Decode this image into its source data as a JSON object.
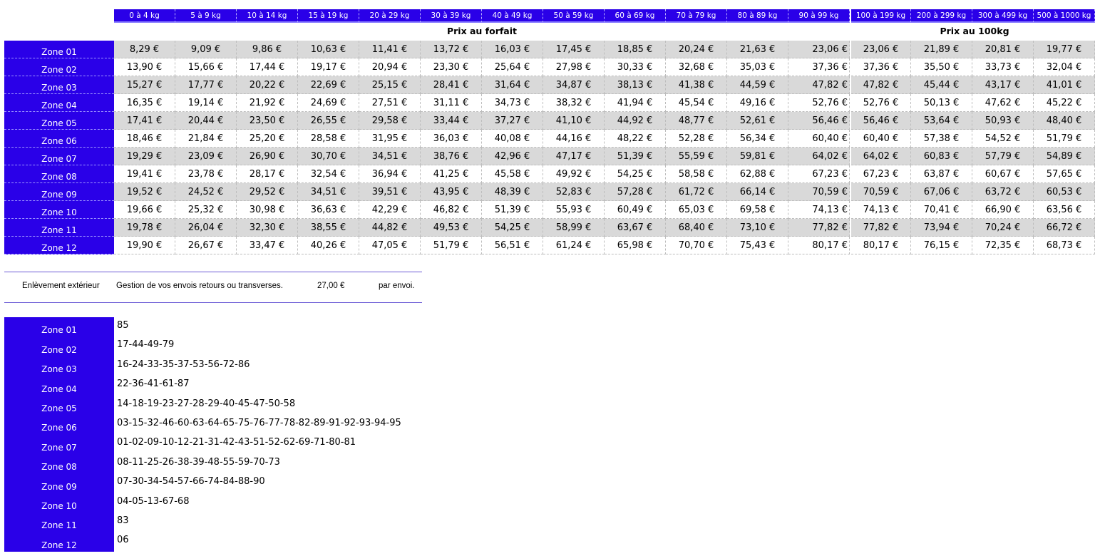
{
  "header": {
    "weights": [
      "0 à 4 kg",
      "5 à 9 kg",
      "10 à 14 kg",
      "15 à 19 kg",
      "20 à 29 kg",
      "30 à 39 kg",
      "40 à 49 kg",
      "50 à 59 kg",
      "60 à 69 kg",
      "70 à 79 kg",
      "80 à 89 kg",
      "90 à 99 kg",
      "100 à 199 kg",
      "200 à 299 kg",
      "300 à 499 kg",
      "500 à 1000 kg"
    ],
    "forfait_label": "Prix au forfait",
    "per100_label": "Prix au 100kg"
  },
  "price_rows": [
    {
      "zone": "Zone 01",
      "prices": [
        "8,29 €",
        "9,09 €",
        "9,86 €",
        "10,63 €",
        "11,41 €",
        "13,72 €",
        "16,03 €",
        "17,45 €",
        "18,85 €",
        "20,24 €",
        "21,63 €",
        "23,06 €",
        "23,06 €",
        "21,89 €",
        "20,81 €",
        "19,77 €"
      ]
    },
    {
      "zone": "Zone 02",
      "prices": [
        "13,90 €",
        "15,66 €",
        "17,44 €",
        "19,17 €",
        "20,94 €",
        "23,30 €",
        "25,64 €",
        "27,98 €",
        "30,33 €",
        "32,68 €",
        "35,03 €",
        "37,36 €",
        "37,36 €",
        "35,50 €",
        "33,73 €",
        "32,04 €"
      ]
    },
    {
      "zone": "Zone 03",
      "prices": [
        "15,27 €",
        "17,77 €",
        "20,22 €",
        "22,69 €",
        "25,15 €",
        "28,41 €",
        "31,64 €",
        "34,87 €",
        "38,13 €",
        "41,38 €",
        "44,59 €",
        "47,82 €",
        "47,82 €",
        "45,44 €",
        "43,17 €",
        "41,01 €"
      ]
    },
    {
      "zone": "Zone 04",
      "prices": [
        "16,35 €",
        "19,14 €",
        "21,92 €",
        "24,69 €",
        "27,51 €",
        "31,11 €",
        "34,73 €",
        "38,32 €",
        "41,94 €",
        "45,54 €",
        "49,16 €",
        "52,76 €",
        "52,76 €",
        "50,13 €",
        "47,62 €",
        "45,22 €"
      ]
    },
    {
      "zone": "Zone 05",
      "prices": [
        "17,41 €",
        "20,44 €",
        "23,50 €",
        "26,55 €",
        "29,58 €",
        "33,44 €",
        "37,27 €",
        "41,10 €",
        "44,92 €",
        "48,77 €",
        "52,61 €",
        "56,46 €",
        "56,46 €",
        "53,64 €",
        "50,93 €",
        "48,40 €"
      ]
    },
    {
      "zone": "Zone 06",
      "prices": [
        "18,46 €",
        "21,84 €",
        "25,20 €",
        "28,58 €",
        "31,95 €",
        "36,03 €",
        "40,08 €",
        "44,16 €",
        "48,22 €",
        "52,28 €",
        "56,34 €",
        "60,40 €",
        "60,40 €",
        "57,38 €",
        "54,52 €",
        "51,79 €"
      ]
    },
    {
      "zone": "Zone 07",
      "prices": [
        "19,29 €",
        "23,09 €",
        "26,90 €",
        "30,70 €",
        "34,51 €",
        "38,76 €",
        "42,96 €",
        "47,17 €",
        "51,39 €",
        "55,59 €",
        "59,81 €",
        "64,02 €",
        "64,02 €",
        "60,83 €",
        "57,79 €",
        "54,89 €"
      ]
    },
    {
      "zone": "Zone 08",
      "prices": [
        "19,41 €",
        "23,78 €",
        "28,17 €",
        "32,54 €",
        "36,94 €",
        "41,25 €",
        "45,58 €",
        "49,92 €",
        "54,25 €",
        "58,58 €",
        "62,88 €",
        "67,23 €",
        "67,23 €",
        "63,87 €",
        "60,67 €",
        "57,65 €"
      ]
    },
    {
      "zone": "Zone 09",
      "prices": [
        "19,52 €",
        "24,52 €",
        "29,52 €",
        "34,51 €",
        "39,51 €",
        "43,95 €",
        "48,39 €",
        "52,83 €",
        "57,28 €",
        "61,72 €",
        "66,14 €",
        "70,59 €",
        "70,59 €",
        "67,06 €",
        "63,72 €",
        "60,53 €"
      ]
    },
    {
      "zone": "Zone 10",
      "prices": [
        "19,66 €",
        "25,32 €",
        "30,98 €",
        "36,63 €",
        "42,29 €",
        "46,82 €",
        "51,39 €",
        "55,93 €",
        "60,49 €",
        "65,03 €",
        "69,58 €",
        "74,13 €",
        "74,13 €",
        "70,41 €",
        "66,90 €",
        "63,56 €"
      ]
    },
    {
      "zone": "Zone 11",
      "prices": [
        "19,78 €",
        "26,04 €",
        "32,30 €",
        "38,55 €",
        "44,82 €",
        "49,53 €",
        "54,25 €",
        "58,99 €",
        "63,67 €",
        "68,40 €",
        "73,10 €",
        "77,82 €",
        "77,82 €",
        "73,94 €",
        "70,24 €",
        "66,72 €"
      ]
    },
    {
      "zone": "Zone 12",
      "prices": [
        "19,90 €",
        "26,67 €",
        "33,47 €",
        "40,26 €",
        "47,05 €",
        "51,79 €",
        "56,51 €",
        "61,24 €",
        "65,98 €",
        "70,70 €",
        "75,43 €",
        "80,17 €",
        "80,17 €",
        "76,15 €",
        "72,35 €",
        "68,73 €"
      ]
    }
  ],
  "pickup": {
    "label": "Enlèvement extérieur",
    "description": "Gestion de vos envois retours ou transverses.",
    "price": "27,00 €",
    "unit": "par envoi."
  },
  "zone_departments": [
    {
      "zone": "Zone 01",
      "codes": "85"
    },
    {
      "zone": "Zone 02",
      "codes": "17-44-49-79"
    },
    {
      "zone": "Zone 03",
      "codes": "16-24-33-35-37-53-56-72-86"
    },
    {
      "zone": "Zone 04",
      "codes": "22-36-41-61-87"
    },
    {
      "zone": "Zone 05",
      "codes": "14-18-19-23-27-28-29-40-45-47-50-58"
    },
    {
      "zone": "Zone 06",
      "codes": "03-15-32-46-60-63-64-65-75-76-77-78-82-89-91-92-93-94-95"
    },
    {
      "zone": "Zone 07",
      "codes": "01-02-09-10-12-21-31-42-43-51-52-62-69-71-80-81"
    },
    {
      "zone": "Zone 08",
      "codes": "08-11-25-26-38-39-48-55-59-70-73"
    },
    {
      "zone": "Zone 09",
      "codes": "07-30-34-54-57-66-74-84-88-90"
    },
    {
      "zone": "Zone 10",
      "codes": "04-05-13-67-68"
    },
    {
      "zone": "Zone 11",
      "codes": "83"
    },
    {
      "zone": "Zone 12",
      "codes": "06"
    }
  ],
  "colors": {
    "zone_bg": "#2a00e8",
    "stripe": "#d9d9d9",
    "rule": "#6b5bd6"
  }
}
